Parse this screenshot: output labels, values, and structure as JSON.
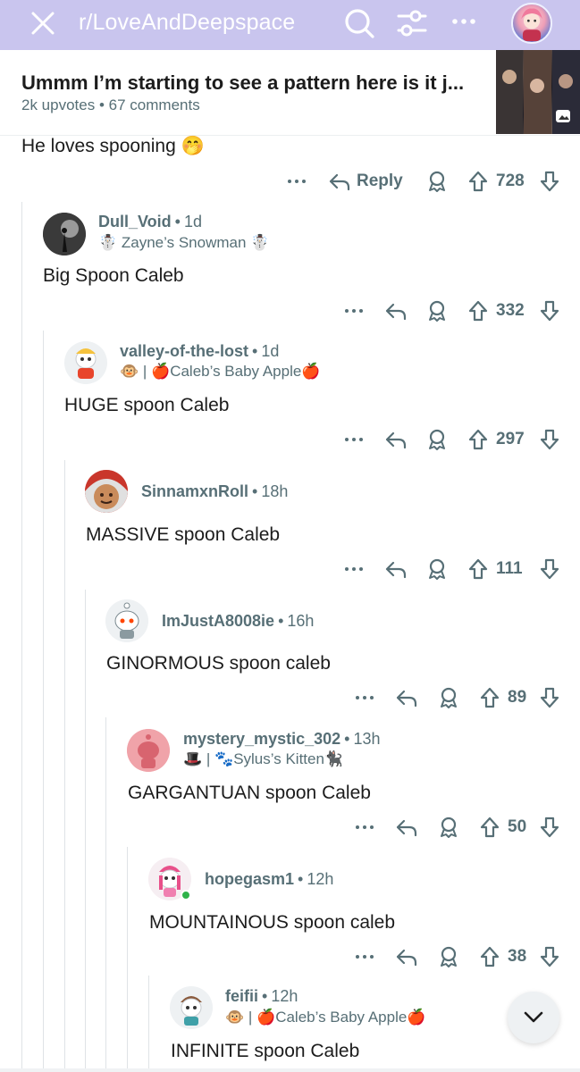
{
  "header": {
    "subreddit": "r/LoveAndDeepspace",
    "bg_color": "#c9c5ee"
  },
  "post": {
    "title": "Ummm I’m starting to see a pattern here is it j...",
    "upvotes": "2k upvotes",
    "comments": "67 comments"
  },
  "top_comment": {
    "text": "He loves spooning 🤭",
    "reply_label": "Reply",
    "score": "728"
  },
  "comments": [
    {
      "author": "Dull_Void",
      "age": "1d",
      "flair": "☃️ Zayne’s Snowman ☃️",
      "text": "Big Spoon Caleb",
      "score": "332"
    },
    {
      "author": "valley-of-the-lost",
      "age": "1d",
      "flair": "🐵 | 🍎Caleb’s Baby Apple🍎",
      "text": "HUGE spoon Caleb",
      "score": "297"
    },
    {
      "author": "SinnamxnRoll",
      "age": "18h",
      "flair": "",
      "text": "MASSIVE spoon Caleb",
      "score": "111"
    },
    {
      "author": "ImJustA8008ie",
      "age": "16h",
      "flair": "",
      "text": "GINORMOUS spoon caleb",
      "score": "89"
    },
    {
      "author": "mystery_mystic_302",
      "age": "13h",
      "flair": "🎩 | 🐾Sylus’s Kitten🐈‍⬛",
      "text": "GARGANTUAN spoon Caleb",
      "score": "50"
    },
    {
      "author": "hopegasm1",
      "age": "12h",
      "flair": "",
      "text": "MOUNTAINOUS spoon caleb",
      "score": "38"
    },
    {
      "author": "feifii",
      "age": "12h",
      "flair": "🐵 | 🍎Caleb’s Baby Apple🍎",
      "text": "INFINITE spoon Caleb",
      "score": ""
    }
  ],
  "icons": {
    "close": "close-icon",
    "search": "search-icon",
    "filter": "filter-icon",
    "more": "more-icon",
    "reply": "reply-icon",
    "award": "award-icon",
    "upvote": "upvote-icon",
    "downvote": "downvote-icon",
    "collapse": "chevron-down-icon"
  }
}
